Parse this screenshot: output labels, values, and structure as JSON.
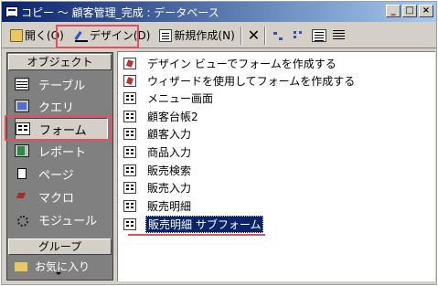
{
  "titlebar": {
    "title": "コピー ～ 顧客管理_完成 : データベース",
    "minimize": "_",
    "maximize": "□",
    "close": "×"
  },
  "toolbar": {
    "open_label": "開く(O)",
    "design_label": "デザイン(D)",
    "new_label": "新規作成(N)",
    "delete_label": "✕"
  },
  "sidebar": {
    "header": "オブジェクト",
    "items": [
      {
        "label": "テーブル",
        "icon": "table-icon"
      },
      {
        "label": "クエリ",
        "icon": "query-icon"
      },
      {
        "label": "フォーム",
        "icon": "form-icon"
      },
      {
        "label": "レポート",
        "icon": "report-icon"
      },
      {
        "label": "ページ",
        "icon": "page-icon"
      },
      {
        "label": "マクロ",
        "icon": "macro-icon"
      },
      {
        "label": "モジュール",
        "icon": "module-icon"
      }
    ],
    "group_header": "グループ",
    "group_first": "お気に入り"
  },
  "list": {
    "items": [
      {
        "label": "デザイン ビューでフォームを作成する",
        "icon": "wizard-icon"
      },
      {
        "label": "ウィザードを使用してフォームを作成する",
        "icon": "wizard-icon"
      },
      {
        "label": "メニュー画面",
        "icon": "form-icon"
      },
      {
        "label": "顧客台帳2",
        "icon": "form-icon"
      },
      {
        "label": "顧客入力",
        "icon": "form-icon"
      },
      {
        "label": "商品入力",
        "icon": "form-icon"
      },
      {
        "label": "販売検索",
        "icon": "form-icon"
      },
      {
        "label": "販売入力",
        "icon": "form-icon"
      },
      {
        "label": "販売明細",
        "icon": "form-icon"
      },
      {
        "label": "販売明細 サブフォーム",
        "icon": "form-icon"
      }
    ],
    "selected_index": 9
  },
  "colors": {
    "titlebar_start": "#0a246a",
    "titlebar_end": "#a6caf0",
    "highlight": "#e05060",
    "selection": "#0a246a",
    "sidebar_bg": "#808080"
  }
}
